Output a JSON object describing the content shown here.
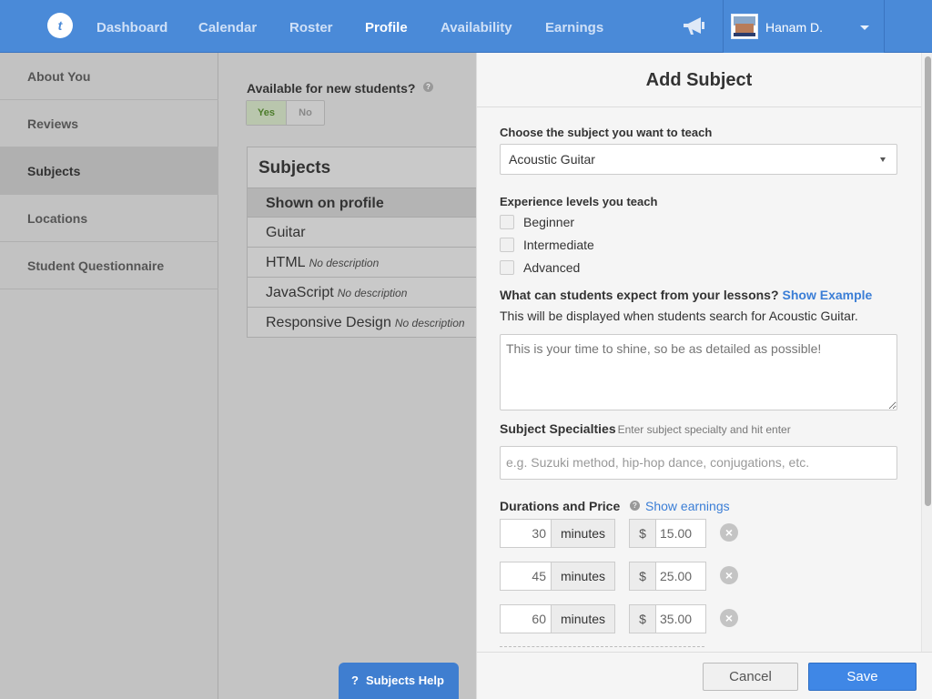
{
  "nav": {
    "logo_text": "t",
    "items": [
      {
        "label": "Dashboard"
      },
      {
        "label": "Calendar"
      },
      {
        "label": "Roster"
      },
      {
        "label": "Profile"
      },
      {
        "label": "Availability"
      },
      {
        "label": "Earnings"
      }
    ],
    "active_item": "Profile",
    "user_name": "Hanam D."
  },
  "sidebar": {
    "items": [
      {
        "label": "About You"
      },
      {
        "label": "Reviews"
      },
      {
        "label": "Subjects"
      },
      {
        "label": "Locations"
      },
      {
        "label": "Student Questionnaire"
      }
    ],
    "active_item": "Subjects"
  },
  "main": {
    "available_label": "Available for new students?",
    "toggle": {
      "yes": "Yes",
      "no": "No",
      "selected": "Yes"
    },
    "subjects_title": "Subjects",
    "shown_on_profile": "Shown on profile",
    "subjects": [
      {
        "name": "Guitar",
        "desc": ""
      },
      {
        "name": "HTML",
        "desc": "No description"
      },
      {
        "name": "JavaScript",
        "desc": "No description"
      },
      {
        "name": "Responsive Design",
        "desc": "No description"
      }
    ],
    "help_button": "Subjects Help",
    "help_button_icon": "?"
  },
  "panel": {
    "title": "Add Subject",
    "choose_label": "Choose the subject you want to teach",
    "selected_subject": "Acoustic Guitar",
    "levels_label": "Experience levels you teach",
    "levels": [
      {
        "label": "Beginner",
        "checked": false
      },
      {
        "label": "Intermediate",
        "checked": false
      },
      {
        "label": "Advanced",
        "checked": false
      }
    ],
    "expect_label": "What can students expect from your lessons?",
    "show_example": "Show Example",
    "expect_desc": "This will be displayed when students search for Acoustic Guitar.",
    "textarea_placeholder": "This is your time to shine, so be as detailed as possible!",
    "specialties_label": "Subject Specialties",
    "specialties_hint": "Enter subject specialty and hit enter",
    "specialties_placeholder": "e.g. Suzuki method, hip-hop dance, conjugations,  etc.",
    "durations_label": "Durations and Price",
    "show_earnings": "Show earnings",
    "durations": [
      {
        "minutes": "30",
        "unit": "minutes",
        "currency": "$",
        "price": "15.00"
      },
      {
        "minutes": "45",
        "unit": "minutes",
        "currency": "$",
        "price": "25.00"
      },
      {
        "minutes": "60",
        "unit": "minutes",
        "currency": "$",
        "price": "35.00"
      }
    ],
    "cancel": "Cancel",
    "save": "Save"
  },
  "colors": {
    "nav_blue": "#4a8ad8",
    "accent_blue": "#3f87e6",
    "link_blue": "#3b7ed6"
  }
}
